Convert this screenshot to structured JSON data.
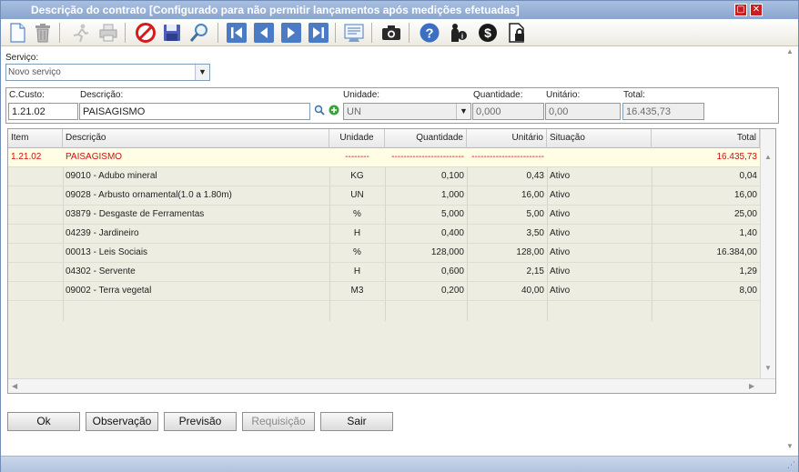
{
  "window": {
    "title": "Descrição do contrato [Configurado para não permitir lançamentos após medições efetuadas]"
  },
  "toolbar": {
    "icons": [
      "new-document-icon",
      "trash-icon",
      "run-icon",
      "printer-icon",
      "stop-icon",
      "save-icon",
      "search-icon",
      "first-record-icon",
      "previous-record-icon",
      "next-record-icon",
      "last-record-icon",
      "report-icon",
      "camera-icon",
      "help-icon",
      "user-info-icon",
      "money-icon",
      "document-lock-icon"
    ]
  },
  "servico": {
    "label": "Serviço:",
    "value": "Novo serviço"
  },
  "form": {
    "ccusto_label": "C.Custo:",
    "ccusto_value": "1.21.02",
    "descricao_label": "Descrição:",
    "descricao_value": "PAISAGISMO",
    "unidade_label": "Unidade:",
    "unidade_value": "UN",
    "quantidade_label": "Quantidade:",
    "quantidade_value": "0,000",
    "unitario_label": "Unitário:",
    "unitario_value": "0,00",
    "total_label": "Total:",
    "total_value": "16.435,73"
  },
  "grid": {
    "columns": [
      "Item",
      "Descrição",
      "Unidade",
      "Quantidade",
      "Unitário",
      "Situação",
      "Total"
    ],
    "rows": [
      {
        "item": "1.21.02",
        "descricao": "PAISAGISMO",
        "unidade": "--------",
        "quantidade": "------------------------",
        "unitario": "------------------------",
        "situacao": "",
        "total": "16.435,73"
      },
      {
        "item": "",
        "descricao": "09010 - Adubo mineral",
        "unidade": "KG",
        "quantidade": "0,100",
        "unitario": "0,43",
        "situacao": "Ativo",
        "total": "0,04"
      },
      {
        "item": "",
        "descricao": "09028 - Arbusto ornamental(1.0 a 1.80m)",
        "unidade": "UN",
        "quantidade": "1,000",
        "unitario": "16,00",
        "situacao": "Ativo",
        "total": "16,00"
      },
      {
        "item": "",
        "descricao": "03879 - Desgaste de Ferramentas",
        "unidade": "%",
        "quantidade": "5,000",
        "unitario": "5,00",
        "situacao": "Ativo",
        "total": "25,00"
      },
      {
        "item": "",
        "descricao": "04239 - Jardineiro",
        "unidade": "H",
        "quantidade": "0,400",
        "unitario": "3,50",
        "situacao": "Ativo",
        "total": "1,40"
      },
      {
        "item": "",
        "descricao": "00013 - Leis Sociais",
        "unidade": "%",
        "quantidade": "128,000",
        "unitario": "128,00",
        "situacao": "Ativo",
        "total": "16.384,00"
      },
      {
        "item": "",
        "descricao": "04302 - Servente",
        "unidade": "H",
        "quantidade": "0,600",
        "unitario": "2,15",
        "situacao": "Ativo",
        "total": "1,29"
      },
      {
        "item": "",
        "descricao": "09002 - Terra vegetal",
        "unidade": "M3",
        "quantidade": "0,200",
        "unitario": "40,00",
        "situacao": "Ativo",
        "total": "8,00"
      }
    ]
  },
  "buttons": {
    "ok": "Ok",
    "observacao": "Observação",
    "previsao": "Previsão",
    "requisicao": "Requisição",
    "sair": "Sair"
  },
  "colors": {
    "titlebar": "#8aa5cf",
    "highlight_row_text": "#d01010",
    "highlight_row_bg": "#fffde4",
    "grid_body": "#eeede2"
  }
}
